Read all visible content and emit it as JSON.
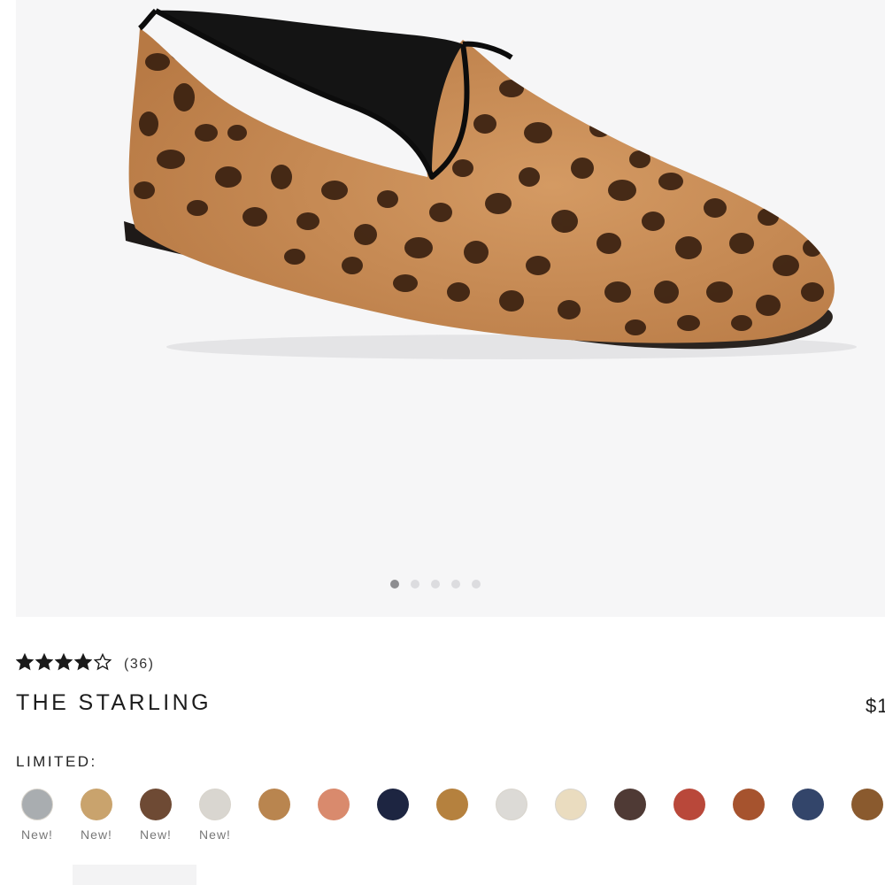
{
  "gallery": {
    "image_alt": "Leopard print calf hair smoking loafer",
    "slide_count": 5,
    "active_slide": 1,
    "dots": [
      "slide-1",
      "slide-2",
      "slide-3",
      "slide-4",
      "slide-5"
    ]
  },
  "product": {
    "rating": 4,
    "rating_max": 5,
    "review_count": "(36)",
    "name": "THE STARLING",
    "price": "$1"
  },
  "colors": {
    "label": "LIMITED:",
    "swatches": [
      {
        "name": "grey-tweed",
        "color": "#a9adb0",
        "new_label": "New!"
      },
      {
        "name": "tan-woven",
        "color": "#c9a36d",
        "new_label": "New!"
      },
      {
        "name": "brown-stripe",
        "color": "#6e4a34",
        "new_label": "New!"
      },
      {
        "name": "zebra",
        "color": "#d9d6d0",
        "new_label": "New!"
      },
      {
        "name": "leopard",
        "color": "#b9854f",
        "new_label": ""
      },
      {
        "name": "terracotta",
        "color": "#d98a6d",
        "new_label": ""
      },
      {
        "name": "navy",
        "color": "#1d2541",
        "new_label": ""
      },
      {
        "name": "camel",
        "color": "#b5813e",
        "new_label": ""
      },
      {
        "name": "light-grey",
        "color": "#dcdad6",
        "new_label": ""
      },
      {
        "name": "cream-floral",
        "color": "#eadcbf",
        "new_label": ""
      },
      {
        "name": "dark-brown",
        "color": "#4f3a35",
        "new_label": ""
      },
      {
        "name": "rust",
        "color": "#b9483a",
        "new_label": ""
      },
      {
        "name": "paisley",
        "color": "#a6532e",
        "new_label": ""
      },
      {
        "name": "navy-floral",
        "color": "#33456a",
        "new_label": ""
      },
      {
        "name": "leopard-dark",
        "color": "#8a5a2e",
        "new_label": ""
      }
    ]
  },
  "accent_colors": {
    "background": "#f6f6f7",
    "shoe_base": "#c98b56",
    "spot": "#3a2111",
    "star": "#1a1a1a"
  }
}
